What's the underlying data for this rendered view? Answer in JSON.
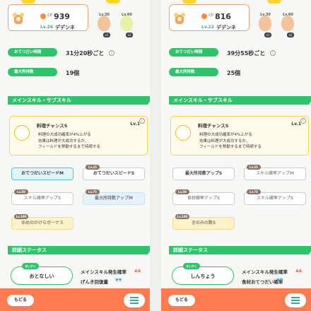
{
  "panels": [
    {
      "cp_label": "CP",
      "cp": "939",
      "level": "Lv.26",
      "name": "デデンネ",
      "ingredients": [
        {
          "lv": "Lv.30",
          "count": "x1",
          "color": "#f3c49c"
        },
        {
          "lv": "Lv.60",
          "count": "x2",
          "color": "#e8f0a6"
        }
      ],
      "stats": [
        {
          "label": "おてつだい時間",
          "value": "31分20秒ごと"
        },
        {
          "label": "最大所持数",
          "value": "19個"
        }
      ],
      "section_skill": "メインスキル・サブスキル",
      "skill": {
        "name": "料理チャンスS",
        "lv": "Lv.1",
        "desc": "料理の大成功確率が4%上がる\n効果は料理が大成功するか、\nフィールドを移動するまで持続する"
      },
      "subskills": [
        {
          "label": "おてつだいスピードM",
          "tag": "",
          "style": "active"
        },
        {
          "label": "おてつだいスピードS",
          "tag": "Lv.25",
          "style": "normal"
        },
        {
          "label": "スキル確率アップS",
          "tag": "Lv.50",
          "style": "locked"
        },
        {
          "label": "最大所持数アップM",
          "tag": "Lv.75",
          "style": "lightblue"
        },
        {
          "label": "ゆめのかけらボーナス",
          "tag": "Lv.100",
          "style": "gold"
        }
      ],
      "section_detail": "詳細ステータス",
      "nature_tag": "せいかく",
      "nature": "おとなしい",
      "effects": [
        {
          "label": "メインスキル発生確率",
          "dir": "up"
        },
        {
          "label": "げんき回復量",
          "dir": "down"
        }
      ],
      "back": "もどる"
    },
    {
      "cp_label": "CP",
      "cp": "816",
      "level": "Lv.22",
      "name": "デデンネ",
      "ingredients": [
        {
          "lv": "Lv.30",
          "count": "x1",
          "color": "#f3c49c"
        },
        {
          "lv": "Lv.60",
          "count": "x2",
          "color": "#f3c49c"
        }
      ],
      "stats": [
        {
          "label": "おてつだい時間",
          "value": "39分55秒ごと"
        },
        {
          "label": "最大所持数",
          "value": "25個"
        }
      ],
      "section_skill": "メインスキル・サブスキル",
      "skill": {
        "name": "料理チャンスS",
        "lv": "Lv.1",
        "desc": "料理の大成功確率が4%上がる\n効果は料理が大成功するか、\nフィールドを移動するまで持続する"
      },
      "subskills": [
        {
          "label": "最大所持数アップS",
          "tag": "",
          "style": "normal"
        },
        {
          "label": "スキル確率アップM",
          "tag": "Lv.25",
          "style": "locked"
        },
        {
          "label": "食材確率アップS",
          "tag": "Lv.50",
          "style": "locked"
        },
        {
          "label": "スキル確率アップS",
          "tag": "Lv.75",
          "style": "locked"
        },
        {
          "label": "きのみの数S",
          "tag": "Lv.100",
          "style": "gold"
        }
      ],
      "section_detail": "詳細ステータス",
      "nature_tag": "せいかく",
      "nature": "しんちょう",
      "effects": [
        {
          "label": "メインスキル発生確率",
          "dir": "up"
        },
        {
          "label": "食材おてつだい確率",
          "dir": "down"
        }
      ],
      "back": "もどる"
    }
  ]
}
